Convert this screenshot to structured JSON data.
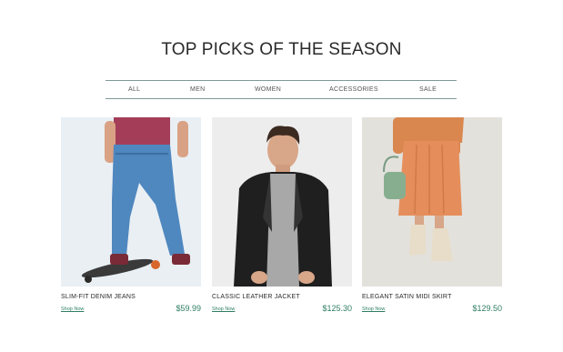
{
  "page": {
    "title": "TOP PICKS OF THE SEASON"
  },
  "nav": {
    "items": [
      {
        "label": "ALL"
      },
      {
        "label": "MEN"
      },
      {
        "label": "WOMEN"
      },
      {
        "label": "ACCESSORIES"
      },
      {
        "label": "SALE"
      }
    ]
  },
  "products": [
    {
      "name": "SLIM-FIT DENIM JEANS",
      "link_label": "Shop Now",
      "price": "$59.99"
    },
    {
      "name": "CLASSIC LEATHER JACKET",
      "link_label": "Shop Now",
      "price": "$125.30"
    },
    {
      "name": "ELEGANT SATIN MIDI SKIRT",
      "link_label": "Shop Now",
      "price": "$129.50"
    }
  ],
  "colors": {
    "accent": "#2e7d64",
    "rule": "#7e9a98",
    "text": "#2a2a2a"
  }
}
